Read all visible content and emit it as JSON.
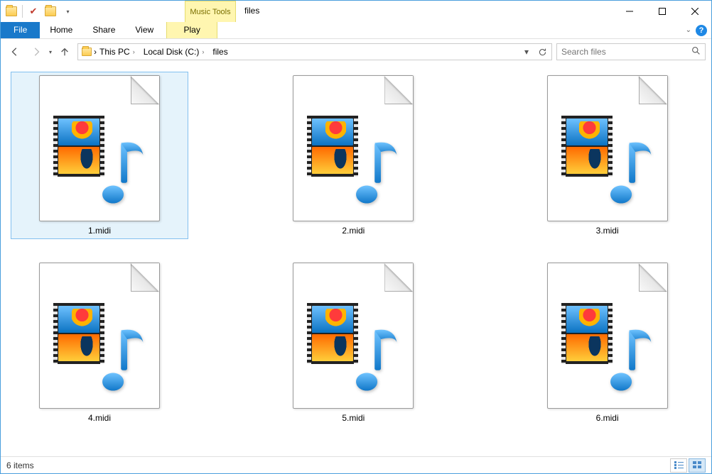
{
  "window": {
    "title": "files",
    "context_tools_label": "Music Tools"
  },
  "ribbon": {
    "file": "File",
    "tabs": [
      "Home",
      "Share",
      "View"
    ],
    "context_tab": "Play"
  },
  "breadcrumb": {
    "segments": [
      "This PC",
      "Local Disk (C:)",
      "files"
    ]
  },
  "search": {
    "placeholder": "Search files"
  },
  "files": [
    {
      "name": "1.midi",
      "selected": true
    },
    {
      "name": "2.midi",
      "selected": false
    },
    {
      "name": "3.midi",
      "selected": false
    },
    {
      "name": "4.midi",
      "selected": false
    },
    {
      "name": "5.midi",
      "selected": false
    },
    {
      "name": "6.midi",
      "selected": false
    }
  ],
  "status": {
    "item_count": "6 items"
  }
}
